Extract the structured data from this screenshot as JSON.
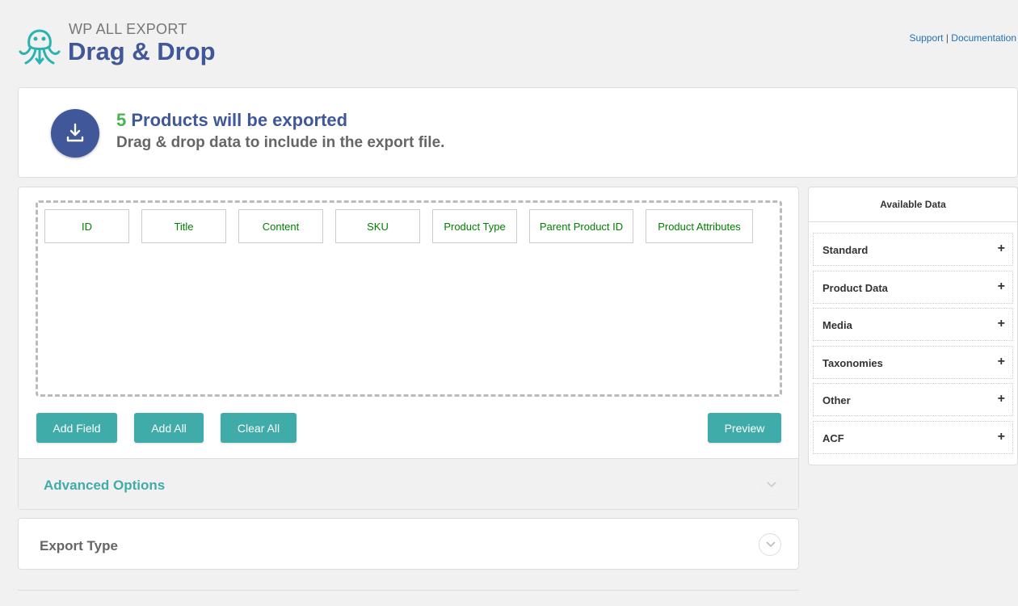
{
  "header": {
    "brand_small": "WP ALL EXPORT",
    "brand_big": "Drag & Drop",
    "support_label": "Support",
    "separator": "|",
    "documentation_label": "Documentation"
  },
  "banner": {
    "count": "5",
    "title_rest": "Products will be exported",
    "subtitle": "Drag & drop data to include in the export file.",
    "icon": "download-icon"
  },
  "fields": [
    {
      "label": "ID"
    },
    {
      "label": "Title"
    },
    {
      "label": "Content"
    },
    {
      "label": "SKU"
    },
    {
      "label": "Product Type"
    },
    {
      "label": "Parent Product ID"
    },
    {
      "label": "Product Attributes"
    }
  ],
  "buttons": {
    "add_field": "Add Field",
    "add_all": "Add All",
    "clear_all": "Clear All",
    "preview": "Preview"
  },
  "advanced": {
    "title": "Advanced Options",
    "icon": "chevron-down-icon"
  },
  "export_type": {
    "title": "Export Type",
    "icon": "chevron-down-icon"
  },
  "available_data": {
    "title": "Available Data",
    "items": [
      {
        "label": "Standard",
        "toggle": "+"
      },
      {
        "label": "Product Data",
        "toggle": "+"
      },
      {
        "label": "Media",
        "toggle": "+"
      },
      {
        "label": "Taxonomies",
        "toggle": "+"
      },
      {
        "label": "Other",
        "toggle": "+"
      },
      {
        "label": "ACF",
        "toggle": "+"
      }
    ]
  },
  "colors": {
    "brand": "#40579a",
    "accent": "#40acaa",
    "count": "#46b450",
    "field_text": "#008000"
  }
}
